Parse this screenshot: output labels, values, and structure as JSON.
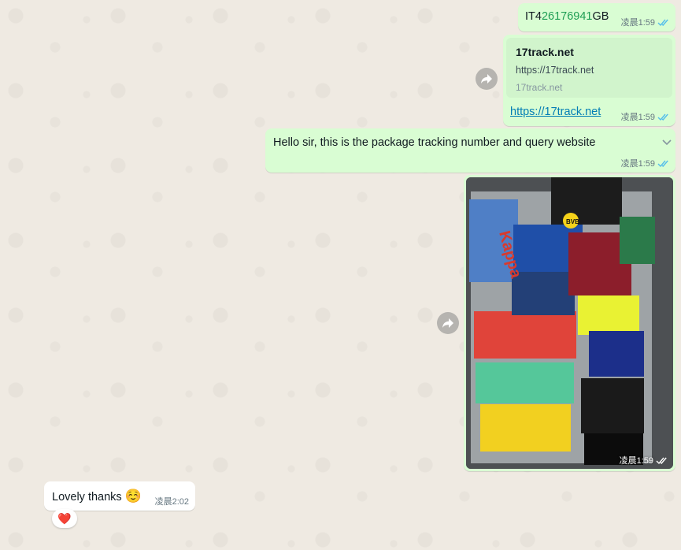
{
  "messages": {
    "tracking": {
      "prefix": "IT4",
      "number": "26176941",
      "suffix": "GB",
      "time": "凌晨1:59"
    },
    "link_message": {
      "preview_title": "17track.net",
      "preview_url": "https://17track.net",
      "preview_domain": "17track.net",
      "link_text": "https://17track.net",
      "time": "凌晨1:59"
    },
    "text_message": {
      "text": "Hello sir, this is the package tracking number and query website",
      "time": "凌晨1:59"
    },
    "photo_message": {
      "time": "凌晨1:59",
      "photo_labels": [
        "Kappa",
        "BVB"
      ]
    },
    "reply": {
      "text": "Lovely thanks",
      "emoji": "☺️",
      "time": "凌晨2:02",
      "reaction": "❤️"
    }
  },
  "colors": {
    "outgoing_bubble": "#d9fdd3",
    "incoming_bubble": "#ffffff",
    "read_ticks": "#53bdeb",
    "link": "#027eb5",
    "tracking_digits": "#1f9e54"
  },
  "icons": {
    "forward": "forward-icon",
    "read_receipt": "double-check-icon",
    "menu": "chevron-down-icon"
  }
}
